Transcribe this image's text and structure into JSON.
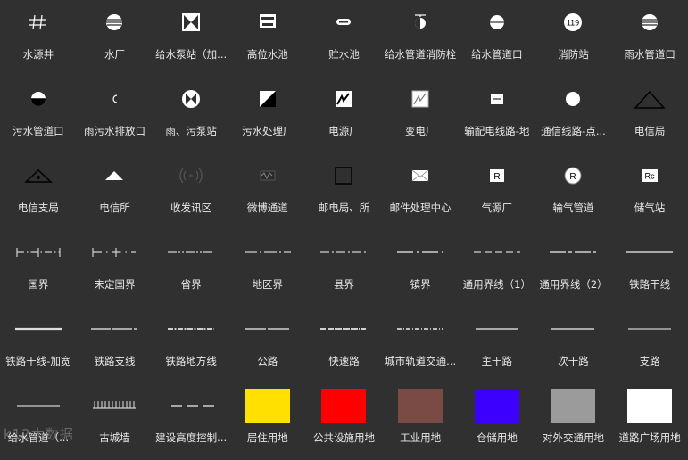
{
  "symbols": [
    {
      "label": "水源井",
      "icon": "hash-icon"
    },
    {
      "label": "水厂",
      "icon": "striped-circle-icon"
    },
    {
      "label": "给水泵站（加...",
      "icon": "bowtie-square-icon"
    },
    {
      "label": "高位水池",
      "icon": "tank-icon"
    },
    {
      "label": "贮水池",
      "icon": "pill-icon"
    },
    {
      "label": "给水管道消防栓",
      "icon": "hydrant-icon"
    },
    {
      "label": "给水管道口",
      "icon": "half-circle-icon"
    },
    {
      "label": "消防站",
      "icon": "fire-station-icon",
      "text": "119"
    },
    {
      "label": "雨水管道口",
      "icon": "striped-circle-icon"
    },
    {
      "label": "污水管道口",
      "icon": "half-filled-circle-icon"
    },
    {
      "label": "雨污水排放口",
      "icon": "outlet-icon"
    },
    {
      "label": "雨、污泵站",
      "icon": "pump-circle-icon"
    },
    {
      "label": "污水处理厂",
      "icon": "diagonal-square-icon"
    },
    {
      "label": "电源厂",
      "icon": "lightning-square-icon"
    },
    {
      "label": "变电厂",
      "icon": "substation-icon"
    },
    {
      "label": "输配电线路-地",
      "icon": "power-line-icon"
    },
    {
      "label": "通信线路-点...",
      "icon": "circle-icon"
    },
    {
      "label": "电信局",
      "icon": "triangle-outline-icon"
    },
    {
      "label": "电信支局",
      "icon": "triangle-dot-icon"
    },
    {
      "label": "电信所",
      "icon": "filled-triangle-icon"
    },
    {
      "label": "收发讯区",
      "icon": "antenna-icon"
    },
    {
      "label": "微博通道",
      "icon": "microwave-icon"
    },
    {
      "label": "邮电局、所",
      "icon": "square-outline-icon"
    },
    {
      "label": "邮件处理中心",
      "icon": "envelope-icon"
    },
    {
      "label": "气源厂",
      "icon": "r-square-icon",
      "text": "R"
    },
    {
      "label": "输气管道",
      "icon": "r-circle-icon",
      "text": "R"
    },
    {
      "label": "储气站",
      "icon": "rc-square-icon",
      "text": "Rc"
    },
    {
      "label": "国界",
      "icon": "line-national-icon"
    },
    {
      "label": "未定国界",
      "icon": "line-undetermined-icon"
    },
    {
      "label": "省界",
      "icon": "line-province-icon"
    },
    {
      "label": "地区界",
      "icon": "line-region-icon"
    },
    {
      "label": "县界",
      "icon": "line-county-icon"
    },
    {
      "label": "镇界",
      "icon": "line-town-icon"
    },
    {
      "label": "通用界线（1）",
      "icon": "line-general1-icon"
    },
    {
      "label": "通用界线（2）",
      "icon": "line-general2-icon"
    },
    {
      "label": "铁路干线",
      "icon": "line-railway-icon"
    },
    {
      "label": "铁路干线-加宽",
      "icon": "line-railway-wide-icon"
    },
    {
      "label": "铁路支线",
      "icon": "line-rail-branch-icon"
    },
    {
      "label": "铁路地方线",
      "icon": "line-rail-local-icon"
    },
    {
      "label": "公路",
      "icon": "line-road-icon"
    },
    {
      "label": "快速路",
      "icon": "line-expressway-icon"
    },
    {
      "label": "城市轨道交通...",
      "icon": "line-metro-icon"
    },
    {
      "label": "主干路",
      "icon": "line-arterial-icon"
    },
    {
      "label": "次干路",
      "icon": "line-secondary-icon"
    },
    {
      "label": "支路",
      "icon": "line-branch-icon"
    },
    {
      "label": "给水管道（...",
      "icon": "line-water-pipe-icon"
    },
    {
      "label": "古城墙",
      "icon": "line-city-wall-icon"
    },
    {
      "label": "建设高度控制...",
      "icon": "line-height-control-icon"
    },
    {
      "label": "居住用地",
      "icon": "color-swatch",
      "color": "#ffe000"
    },
    {
      "label": "公共设施用地",
      "icon": "color-swatch",
      "color": "#ff0000"
    },
    {
      "label": "工业用地",
      "icon": "color-swatch",
      "color": "#7a4a45"
    },
    {
      "label": "仓储用地",
      "icon": "color-swatch",
      "color": "#3c00ff"
    },
    {
      "label": "对外交通用地",
      "icon": "color-swatch",
      "color": "#9b9b9b"
    },
    {
      "label": "道路广场用地",
      "icon": "color-swatch",
      "color": "#ffffff"
    }
  ],
  "watermark": "k12大数据"
}
